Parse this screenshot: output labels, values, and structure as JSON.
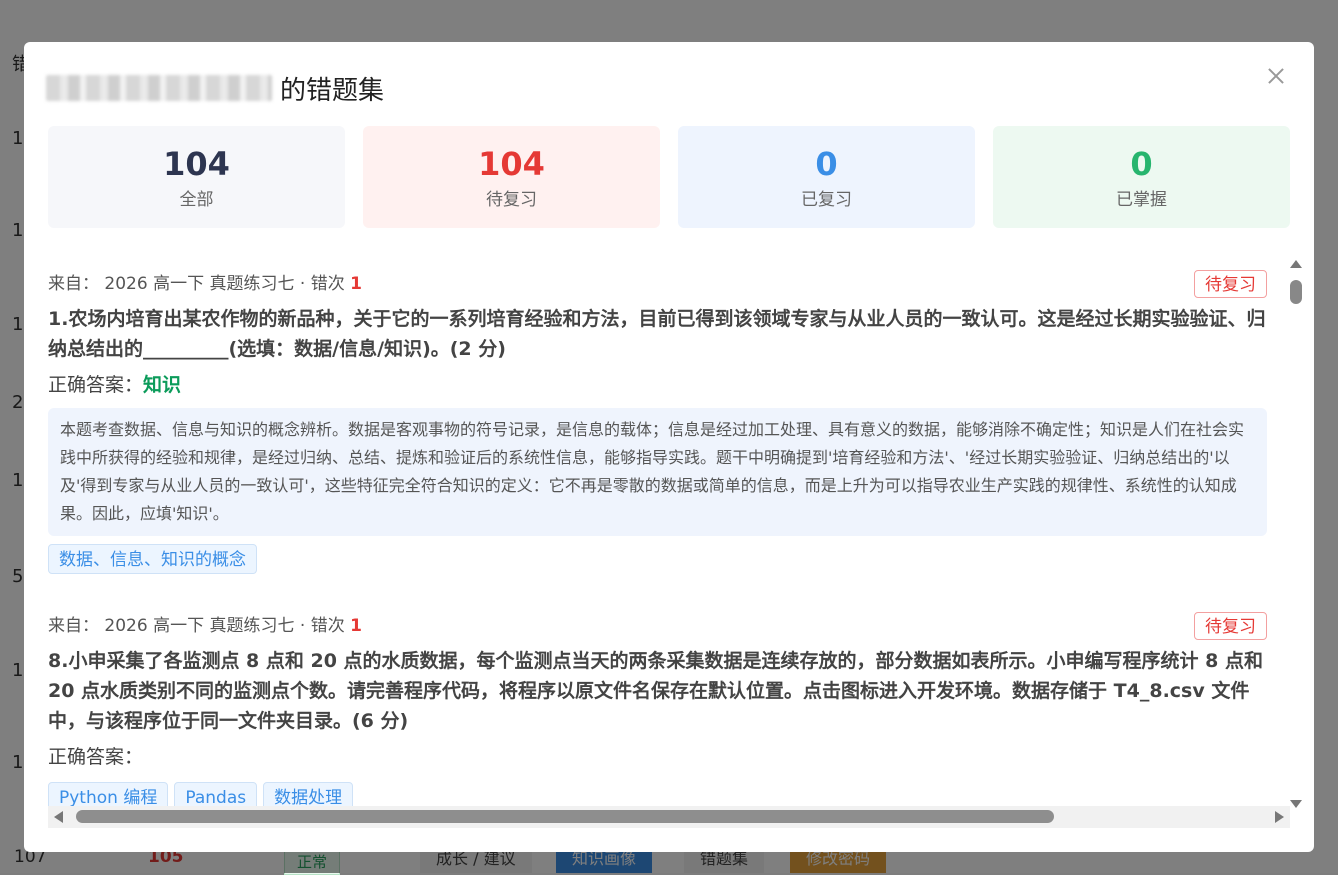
{
  "background": {
    "row_labels": [
      "错",
      "1",
      "1",
      "1",
      "2",
      "1",
      "5",
      "1",
      "1"
    ],
    "bottom_row": {
      "id": "107",
      "score": "105",
      "status": "正常",
      "actions": [
        "成长 / 建议",
        "知识画像",
        "错题集",
        "修改密码"
      ]
    }
  },
  "modal": {
    "title_suffix": "的错题集",
    "stats": [
      {
        "value": "104",
        "label": "全部",
        "color": "#2d3550",
        "bg": "#f6f7fa"
      },
      {
        "value": "104",
        "label": "待复习",
        "color": "#e53935",
        "bg": "#fff1f0"
      },
      {
        "value": "0",
        "label": "已复习",
        "color": "#3a8ee6",
        "bg": "#eef4fe"
      },
      {
        "value": "0",
        "label": "已掌握",
        "color": "#27b56e",
        "bg": "#edf9f1"
      }
    ],
    "items": [
      {
        "source_prefix": "来自：",
        "source": "2026 高一下 真题练习七 · 错次",
        "wrong_count": "1",
        "status": "待复习",
        "question": "1.农场内培育出某农作物的新品种，关于它的一系列培育经验和方法，目前已得到该领域专家与从业人员的一致认可。这是经过长期实验验证、归纳总结出的_________(选填：数据/信息/知识)。(2 分)",
        "answer_label": "正确答案：",
        "answer": "知识",
        "explanation": "本题考查数据、信息与知识的概念辨析。数据是客观事物的符号记录，是信息的载体；信息是经过加工处理、具有意义的数据，能够消除不确定性；知识是人们在社会实践中所获得的经验和规律，是经过归纳、总结、提炼和验证后的系统性信息，能够指导实践。题干中明确提到'培育经验和方法'、'经过长期实验验证、归纳总结出的'以及'得到专家与从业人员的一致认可'，这些特征完全符合知识的定义：它不再是零散的数据或简单的信息，而是上升为可以指导农业生产实践的规律性、系统性的认知成果。因此，应填'知识'。",
        "tags": [
          "数据、信息、知识的概念"
        ]
      },
      {
        "source_prefix": "来自：",
        "source": "2026 高一下 真题练习七 · 错次",
        "wrong_count": "1",
        "status": "待复习",
        "question": "8.小申采集了各监测点 8 点和 20 点的水质数据，每个监测点当天的两条采集数据是连续存放的，部分数据如表所示。小申编写程序统计 8 点和 20 点水质类别不同的监测点个数。请完善程序代码，将程序以原文件名保存在默认位置。点击图标进入开发环境。数据存储于 T4_8.csv 文件中，与该程序位于同一文件夹目录。(6 分)",
        "answer_label": "正确答案：",
        "answer": "",
        "explanation": "",
        "tags": [
          "Python 编程",
          "Pandas",
          "数据处理"
        ]
      }
    ]
  }
}
